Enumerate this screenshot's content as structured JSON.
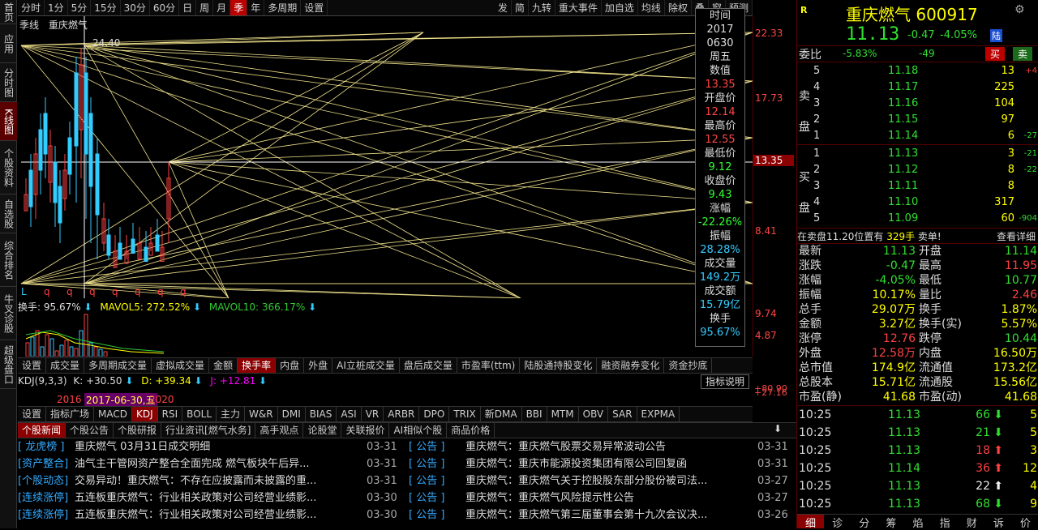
{
  "sidebar": [
    "首页",
    "应用",
    "分时图",
    "K线图",
    "个股资料",
    "自选股",
    "综合排名",
    "牛叉诊股",
    "超级盘口"
  ],
  "toolbar": {
    "left": [
      "分时",
      "1分",
      "5分",
      "15分",
      "30分",
      "60分",
      "日",
      "周",
      "月",
      "季",
      "年",
      "多周期",
      "设置"
    ],
    "right": [
      "发",
      "简",
      "九转",
      "重大事件",
      "加自选",
      "均线",
      "除权",
      "叠",
      "窗",
      "预测"
    ],
    "active": "季"
  },
  "chart": {
    "period_label": "季线",
    "name": "重庆燃气",
    "high_label": "24.40",
    "prices": [
      "22.33",
      "17.73",
      "13.35",
      "8.41"
    ],
    "vol_labels": [
      "9.74",
      "4.87"
    ],
    "bottom_marks": [
      "L",
      "q",
      "q",
      "q",
      "q",
      "q",
      "q",
      "q"
    ]
  },
  "indicator": {
    "turnover": "换手: 95.67%",
    "mavol5": "MAVOL5: 272.52%",
    "mavol10": "MAVOL10: 366.17%"
  },
  "popup": {
    "time_l": "时间",
    "year": "2017",
    "date": "0630",
    "weekday": "周五",
    "value_l": "数值",
    "value": "13.35",
    "open_l": "开盘价",
    "open": "12.14",
    "high_l": "最高价",
    "high": "12.55",
    "low_l": "最低价",
    "low": "9.12",
    "close_l": "收盘价",
    "close": "9.43",
    "chg_l": "涨幅",
    "chg": "-22.26%",
    "amp_l": "振幅",
    "amp": "28.28%",
    "vol_l": "成交量",
    "vol": "149.2万",
    "amt_l": "成交额",
    "amt": "15.79亿",
    "turn_l": "换手",
    "turn": "95.67%"
  },
  "tabs1": [
    "设置",
    "成交量",
    "多周期成交量",
    "虚拟成交量",
    "金额",
    "换手率",
    "内盘",
    "外盘",
    "AI立桩成交量",
    "盘后成交量",
    "市盈率(ttm)",
    "陆股通持股变化",
    "融资融券变化",
    "资金抄底"
  ],
  "kdj": {
    "label": "KDJ(9,3,3)",
    "k": "K: +30.50",
    "d": "D: +39.34",
    "j": "J: +12.81",
    "note": "指标说明",
    "y2016": "2016",
    "cursor": "2017-06-30,五",
    "y2020": "2020",
    "r1": "+80.90",
    "r2": "+27.16"
  },
  "tabs2": [
    "设置",
    "指标广场",
    "MACD",
    "KDJ",
    "RSI",
    "BOLL",
    "主力",
    "W&R",
    "DMI",
    "BIAS",
    "ASI",
    "VR",
    "ARBR",
    "DPO",
    "TRIX",
    "新DMA",
    "BBI",
    "MTM",
    "OBV",
    "SAR",
    "EXPMA"
  ],
  "tabs2_new": "NEW",
  "newstabs": [
    "个股新闻",
    "个股公告",
    "个股研报",
    "行业资讯[燃气水务]",
    "高手观点",
    "论股堂",
    "关联报价",
    "AI相似个股",
    "商品价格"
  ],
  "news_left": [
    {
      "c": "[ 龙虎榜 ]",
      "t": "重庆燃气 03月31日成交明细",
      "d": "03-31"
    },
    {
      "c": "[资产整合]",
      "t": "油气主干管网资产整合全面完成 燃气板块午后异...",
      "d": "03-31"
    },
    {
      "c": "[个股动态]",
      "t": "交易异动！重庆燃气：不存在应披露而未披露的重...",
      "d": "03-31"
    },
    {
      "c": "[连续涨停]",
      "t": "五连板重庆燃气：行业相关政策对公司经营业绩影...",
      "d": "03-30"
    },
    {
      "c": "[连续涨停]",
      "t": "五连板重庆燃气：行业相关政策对公司经营业绩影...",
      "d": "03-30"
    }
  ],
  "news_right": [
    {
      "c": "[  公告  ]",
      "t": "重庆燃气：重庆燃气股票交易异常波动公告",
      "d": "03-31"
    },
    {
      "c": "[  公告  ]",
      "t": "重庆燃气：重庆市能源投资集团有限公司回复函",
      "d": "03-31"
    },
    {
      "c": "[  公告  ]",
      "t": "重庆燃气：重庆燃气关于控股股东部分股份被司法...",
      "d": "03-27"
    },
    {
      "c": "[  公告  ]",
      "t": "重庆燃气：重庆燃气风险提示性公告",
      "d": "03-27"
    },
    {
      "c": "[  公告  ]",
      "t": "重庆燃气：重庆燃气第三届董事会第十九次会议决...",
      "d": "03-26"
    }
  ],
  "quote": {
    "r": "R",
    "name": "重庆燃气",
    "code": "600917",
    "price": "11.13",
    "chg": "-0.47",
    "pct": "-4.05%",
    "lu": "陆",
    "wb_l": "委比",
    "wb": "-5.83%",
    "wc": "-49",
    "buy": "买",
    "sell": "卖"
  },
  "sell_l": [
    "卖",
    "盘"
  ],
  "buy_l": [
    "买",
    "盘"
  ],
  "asks": [
    {
      "n": "5",
      "p": "11.18",
      "v": "13",
      "d": "+4"
    },
    {
      "n": "4",
      "p": "11.17",
      "v": "225",
      "d": ""
    },
    {
      "n": "3",
      "p": "11.16",
      "v": "104",
      "d": ""
    },
    {
      "n": "2",
      "p": "11.15",
      "v": "97",
      "d": ""
    },
    {
      "n": "1",
      "p": "11.14",
      "v": "6",
      "d": "-27"
    }
  ],
  "bids": [
    {
      "n": "1",
      "p": "11.13",
      "v": "3",
      "d": "-21"
    },
    {
      "n": "2",
      "p": "11.12",
      "v": "8",
      "d": "-22"
    },
    {
      "n": "3",
      "p": "11.11",
      "v": "8",
      "d": ""
    },
    {
      "n": "4",
      "p": "11.10",
      "v": "317",
      "d": ""
    },
    {
      "n": "5",
      "p": "11.09",
      "v": "60",
      "d": "-904"
    }
  ],
  "notice": {
    "a": "在卖盘11.20位置有",
    "b": "329手",
    "c": "卖单!",
    "link": "查看详细"
  },
  "stats": [
    [
      "最新",
      "11.13",
      "开盘",
      "11.14"
    ],
    [
      "涨跌",
      "-0.47",
      "最高",
      "11.95"
    ],
    [
      "涨幅",
      "-4.05%",
      "最低",
      "10.77"
    ],
    [
      "振幅",
      "10.17%",
      "量比",
      "2.46"
    ],
    [
      "总手",
      "29.07万",
      "换手",
      "1.87%"
    ],
    [
      "金额",
      "3.27亿",
      "换手(实)",
      "5.57%"
    ],
    [
      "涨停",
      "12.76",
      "跌停",
      "10.44"
    ],
    [
      "外盘",
      "12.58万",
      "内盘",
      "16.50万"
    ],
    [
      "总市值",
      "174.9亿",
      "流通值",
      "173.2亿"
    ],
    [
      "总股本",
      "15.71亿",
      "流通股",
      "15.56亿"
    ],
    [
      "市盈(静)",
      "41.68",
      "市盈(动)",
      "41.68"
    ]
  ],
  "ticks": [
    {
      "t": "10:25",
      "p": "11.13",
      "v": "66",
      "a": "down",
      "n": "5"
    },
    {
      "t": "10:25",
      "p": "11.13",
      "v": "21",
      "a": "down",
      "n": "5"
    },
    {
      "t": "10:25",
      "p": "11.13",
      "v": "18",
      "a": "up",
      "n": "3"
    },
    {
      "t": "10:25",
      "p": "11.14",
      "v": "36",
      "a": "up",
      "n": "12"
    },
    {
      "t": "10:25",
      "p": "11.13",
      "v": "22",
      "a": "upw",
      "n": "4"
    },
    {
      "t": "10:25",
      "p": "11.13",
      "v": "68",
      "a": "down",
      "n": "9"
    }
  ],
  "bottomtabs": [
    "细",
    "诊",
    "分",
    "筹",
    "焰",
    "指",
    "财",
    "诉",
    "价"
  ]
}
